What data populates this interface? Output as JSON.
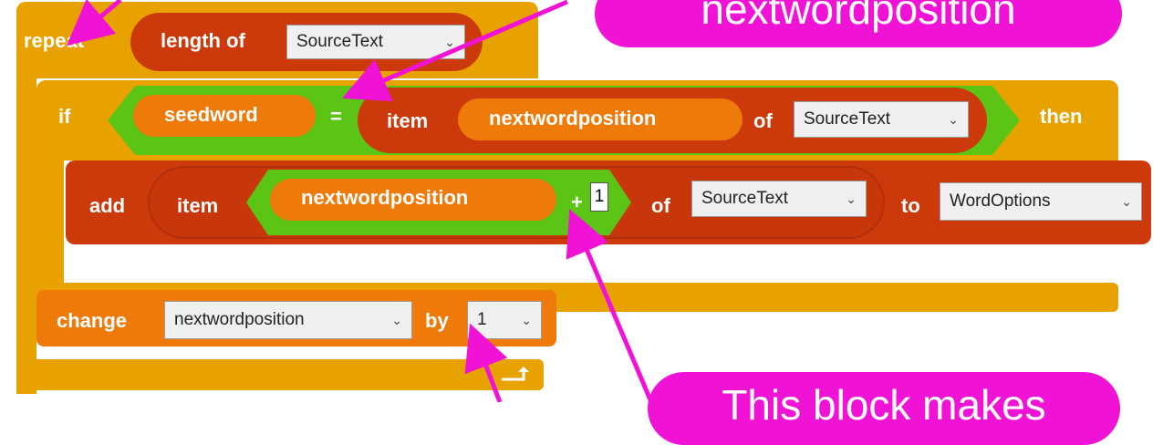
{
  "blocks": {
    "repeat": {
      "keyword": "repeat",
      "count_reporter": {
        "keyword": "length of",
        "list_dropdown": "SourceText"
      }
    },
    "if_block": {
      "keyword_if": "if",
      "keyword_then": "then",
      "condition": {
        "left_var": "seedword",
        "operator": "=",
        "right": {
          "keyword_item": "item",
          "index_var": "nextwordposition",
          "keyword_of": "of",
          "list_dropdown": "SourceText"
        }
      }
    },
    "add_block": {
      "keyword_add": "add",
      "item_reporter": {
        "keyword_item": "item",
        "sum": {
          "var": "nextwordposition",
          "operator": "+",
          "value": "1"
        },
        "keyword_of": "of",
        "list_dropdown": "SourceText"
      },
      "keyword_to": "to",
      "target_list_dropdown": "WordOptions"
    },
    "change_block": {
      "keyword_change": "change",
      "var_dropdown": "nextwordposition",
      "keyword_by": "by",
      "value_dropdown": "1"
    }
  },
  "callouts": {
    "top_right": "nextwordposition",
    "bottom_right": "This block makes"
  },
  "colors": {
    "control": "#e8a200",
    "list": "#cc3a0c",
    "variable": "#ee7a0a",
    "operator": "#5cc415",
    "callout": "#f013d6"
  }
}
